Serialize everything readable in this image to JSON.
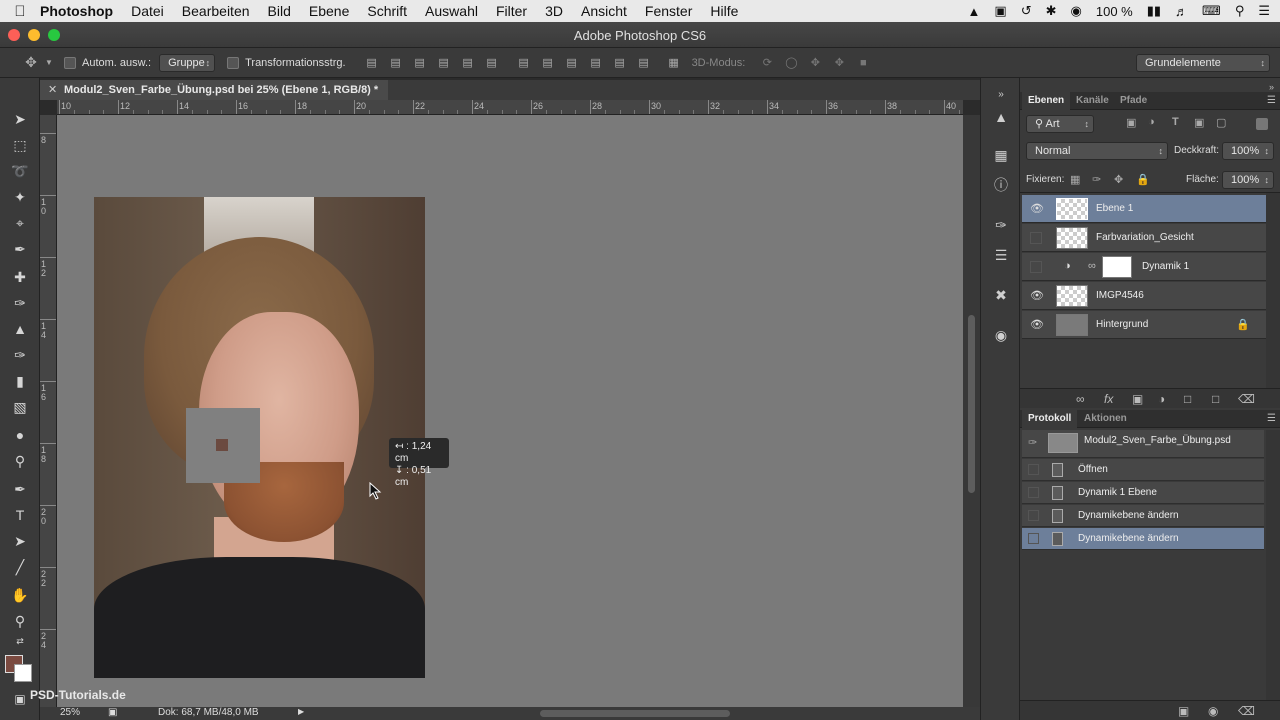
{
  "menubar": {
    "app": "Photoshop",
    "items": [
      "Datei",
      "Bearbeiten",
      "Bild",
      "Ebene",
      "Schrift",
      "Auswahl",
      "Filter",
      "3D",
      "Ansicht",
      "Fenster",
      "Hilfe"
    ],
    "battery": "100 %"
  },
  "window": {
    "title": "Adobe Photoshop CS6"
  },
  "options": {
    "auto_select_label": "Autom. ausw.:",
    "auto_select_value": "Gruppe",
    "transform_label": "Transformationsstrg.",
    "mode_3d_label": "3D-Modus:",
    "workspace": "Grundelemente"
  },
  "document": {
    "tab_title": "Modul2_Sven_Farbe_Übung.psd bei 25% (Ebene 1, RGB/8) *",
    "ruler_h": [
      "10",
      "12",
      "14",
      "16",
      "18",
      "20",
      "22",
      "24",
      "26",
      "28",
      "30",
      "32",
      "34",
      "36",
      "38",
      "40"
    ],
    "ruler_v": [
      "8",
      "10",
      "12",
      "14",
      "16",
      "18",
      "20",
      "22",
      "24"
    ],
    "measure_w": "1,24 cm",
    "measure_h": "0,51 cm",
    "zoom": "25%",
    "doc_size": "Dok: 68,7 MB/48,0 MB"
  },
  "watermark": "PSD-Tutorials.de",
  "colors": {
    "foreground": "#7b4a40",
    "background": "#ffffff",
    "selection": "#6d7f9a"
  },
  "layers_panel": {
    "tabs": [
      "Ebenen",
      "Kanäle",
      "Pfade"
    ],
    "filter_value": "Art",
    "blend_mode": "Normal",
    "opacity_label": "Deckkraft:",
    "opacity_value": "100%",
    "lock_label": "Fixieren:",
    "fill_label": "Fläche:",
    "fill_value": "100%",
    "layers": [
      {
        "name": "Ebene 1",
        "visible": true,
        "selected": true
      },
      {
        "name": "Farbvariation_Gesicht",
        "visible": false,
        "selected": false
      },
      {
        "name": "Dynamik 1",
        "visible": false,
        "selected": false
      },
      {
        "name": "IMGP4546",
        "visible": true,
        "selected": false
      },
      {
        "name": "Hintergrund",
        "visible": true,
        "selected": false
      }
    ]
  },
  "history_panel": {
    "tabs": [
      "Protokoll",
      "Aktionen"
    ],
    "snapshot": "Modul2_Sven_Farbe_Übung.psd",
    "items": [
      "Öffnen",
      "Dynamik 1 Ebene",
      "Dynamikebene ändern",
      "Dynamikebene ändern"
    ]
  }
}
